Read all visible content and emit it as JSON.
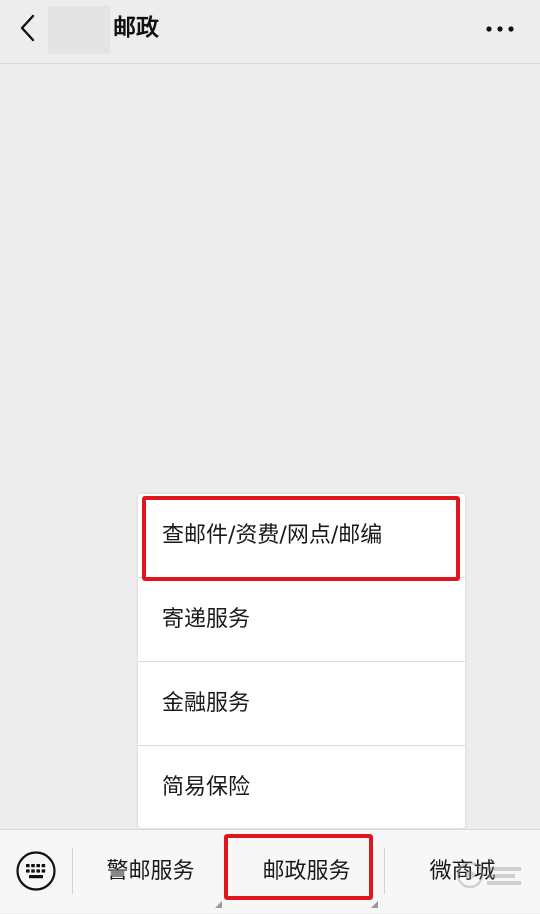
{
  "header": {
    "title": "邮政"
  },
  "menu": {
    "items": [
      {
        "label": "查邮件/资费/网点/邮编"
      },
      {
        "label": "寄递服务"
      },
      {
        "label": "金融服务"
      },
      {
        "label": "简易保险"
      }
    ]
  },
  "bottom_bar": {
    "tabs": [
      {
        "label": "警邮服务"
      },
      {
        "label": "邮政服务"
      },
      {
        "label": "微商城"
      }
    ]
  },
  "colors": {
    "background": "#ededed",
    "highlight": "#e0161e",
    "bar": "#f7f7f7"
  }
}
